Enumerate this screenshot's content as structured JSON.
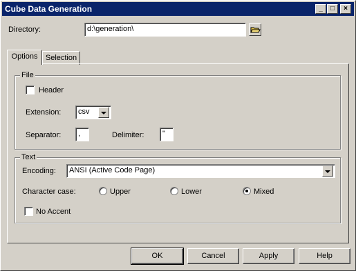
{
  "window": {
    "title": "Cube Data Generation",
    "minimize": "_",
    "maximize": "□",
    "close": "×"
  },
  "directory": {
    "label": "Directory:",
    "value": "d:\\generation\\",
    "browse_icon": "folder-open-icon"
  },
  "tabs": [
    {
      "label": "Options",
      "active": true
    },
    {
      "label": "Selection",
      "active": false
    }
  ],
  "file_group": {
    "title": "File",
    "header_label": "Header",
    "header_checked": false,
    "extension_label": "Extension:",
    "extension_value": "csv",
    "separator_label": "Separator:",
    "separator_value": ",",
    "delimiter_label": "Delimiter:",
    "delimiter_value": "\""
  },
  "text_group": {
    "title": "Text",
    "encoding_label": "Encoding:",
    "encoding_value": "ANSI (Active Code Page)",
    "character_case_label": "Character case:",
    "case_options": [
      "Upper",
      "Lower",
      "Mixed"
    ],
    "case_selected": "Mixed",
    "no_accent_label": "No Accent",
    "no_accent_checked": false
  },
  "buttons": {
    "ok": "OK",
    "cancel": "Cancel",
    "apply": "Apply",
    "help": "Help"
  },
  "colors": {
    "titlebar": "#0a246a",
    "face": "#d4d0c8",
    "folder_icon": "#e8c84a"
  }
}
